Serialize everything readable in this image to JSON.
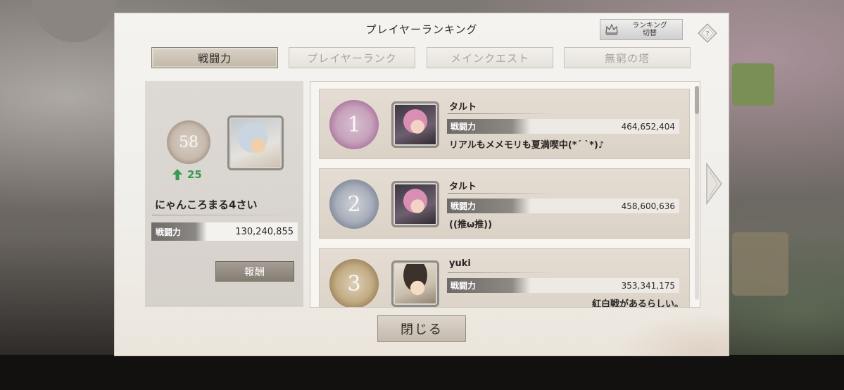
{
  "dialog": {
    "title": "プレイヤーランキング",
    "switch_label": "ランキング\n切替",
    "close_label": "閉じる"
  },
  "tabs": [
    {
      "label": "戦闘力",
      "active": true
    },
    {
      "label": "プレイヤーランク",
      "active": false
    },
    {
      "label": "メインクエスト",
      "active": false
    },
    {
      "label": "無窮の塔",
      "active": false
    }
  ],
  "me": {
    "rank": "58",
    "rank_change": "25",
    "name": "にゃんころまる4さい",
    "stat_label": "戦闘力",
    "stat_value": "130,240,855",
    "reward_label": "報酬"
  },
  "ranking": [
    {
      "rank": "1",
      "name": "タルト",
      "stat_label": "戦闘力",
      "stat_value": "464,652,404",
      "comment": "リアルもメメモリも夏満喫中(*´ `*)♪",
      "badge_color": "#b78fa6"
    },
    {
      "rank": "2",
      "name": "タルト",
      "stat_label": "戦闘力",
      "stat_value": "458,600,636",
      "comment": "((推ω推))",
      "badge_color": "#8e96a3"
    },
    {
      "rank": "3",
      "name": "yuki",
      "stat_label": "戦闘力",
      "stat_value": "353,341,175",
      "comment": "紅白戦があるらしい。",
      "badge_color": "#a7916f"
    }
  ],
  "colors": {
    "accent_green": "#3a9a4f",
    "active_tab": "#c2b8a8"
  },
  "icons": {
    "switch": "crown-icon",
    "help": "help-diamond-icon",
    "rank_up": "arrow-up-icon",
    "next": "chevron-right-icon"
  }
}
